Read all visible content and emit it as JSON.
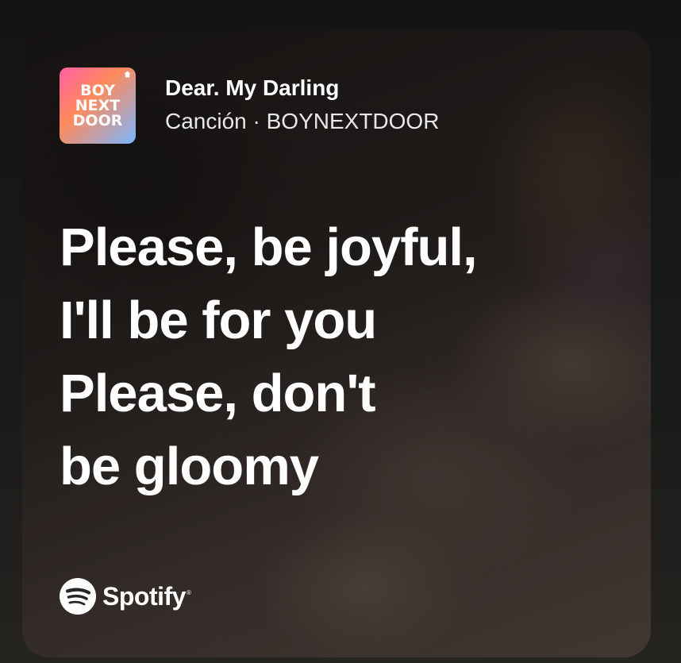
{
  "song": {
    "title": "Dear. My Darling",
    "subtitle": "Canción · BOYNEXTDOOR"
  },
  "cover": {
    "lines": [
      "BOY",
      "NEXT",
      "DOOR"
    ],
    "icon": "home-icon"
  },
  "lyrics": {
    "lines": [
      "Please, be joyful,",
      "I'll be for you",
      "Please, don't",
      "be gloomy"
    ]
  },
  "brand": {
    "name": "Spotify",
    "registered": "®",
    "icon": "spotify-logo-icon"
  },
  "colors": {
    "text": "#ffffff",
    "background": "#161616"
  }
}
